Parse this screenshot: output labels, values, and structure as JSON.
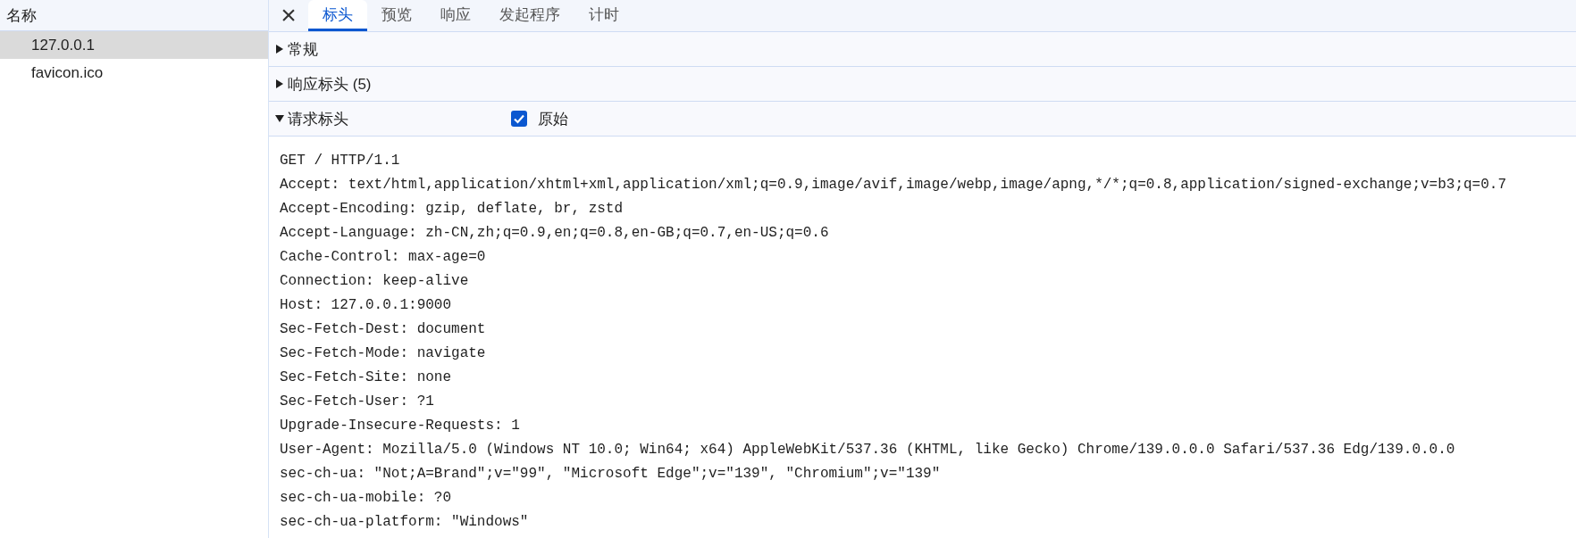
{
  "request_list": {
    "column_header": "名称",
    "items": [
      {
        "name": "127.0.0.1",
        "selected": true
      },
      {
        "name": "favicon.ico",
        "selected": false
      }
    ]
  },
  "detail": {
    "close": "×",
    "tabs": [
      {
        "label": "标头",
        "selected": true
      },
      {
        "label": "预览",
        "selected": false
      },
      {
        "label": "响应",
        "selected": false
      },
      {
        "label": "发起程序",
        "selected": false
      },
      {
        "label": "计时",
        "selected": false
      }
    ],
    "sections": [
      {
        "title": "常规",
        "expanded": false
      },
      {
        "title": "响应标头 (5)",
        "expanded": false
      },
      {
        "title": "请求标头",
        "expanded": true,
        "raw_toggle": {
          "label": "原始",
          "checked": true
        },
        "raw_lines": [
          "GET / HTTP/1.1",
          "Accept: text/html,application/xhtml+xml,application/xml;q=0.9,image/avif,image/webp,image/apng,*/*;q=0.8,application/signed-exchange;v=b3;q=0.7",
          "Accept-Encoding: gzip, deflate, br, zstd",
          "Accept-Language: zh-CN,zh;q=0.9,en;q=0.8,en-GB;q=0.7,en-US;q=0.6",
          "Cache-Control: max-age=0",
          "Connection: keep-alive",
          "Host: 127.0.0.1:9000",
          "Sec-Fetch-Dest: document",
          "Sec-Fetch-Mode: navigate",
          "Sec-Fetch-Site: none",
          "Sec-Fetch-User: ?1",
          "Upgrade-Insecure-Requests: 1",
          "User-Agent: Mozilla/5.0 (Windows NT 10.0; Win64; x64) AppleWebKit/537.36 (KHTML, like Gecko) Chrome/139.0.0.0 Safari/537.36 Edg/139.0.0.0",
          "sec-ch-ua: \"Not;A=Brand\";v=\"99\", \"Microsoft Edge\";v=\"139\", \"Chromium\";v=\"139\"",
          "sec-ch-ua-mobile: ?0",
          "sec-ch-ua-platform: \"Windows\""
        ]
      }
    ]
  }
}
